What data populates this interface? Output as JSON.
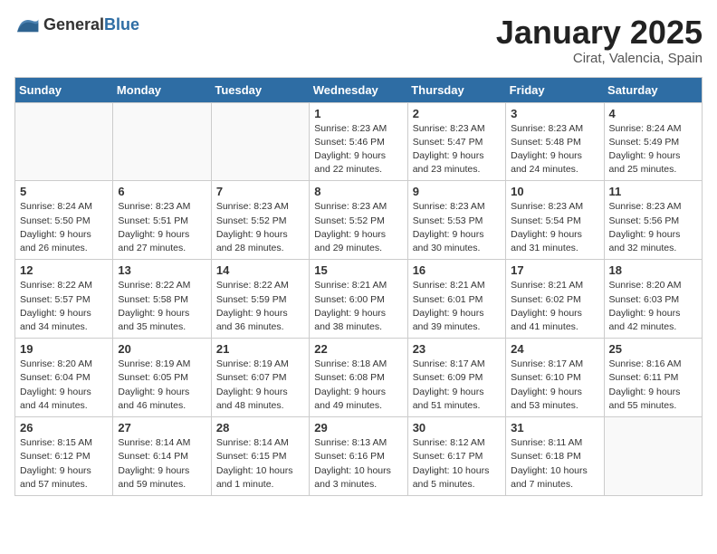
{
  "header": {
    "logo_general": "General",
    "logo_blue": "Blue",
    "title": "January 2025",
    "subtitle": "Cirat, Valencia, Spain"
  },
  "weekdays": [
    "Sunday",
    "Monday",
    "Tuesday",
    "Wednesday",
    "Thursday",
    "Friday",
    "Saturday"
  ],
  "weeks": [
    [
      {
        "day": "",
        "info": ""
      },
      {
        "day": "",
        "info": ""
      },
      {
        "day": "",
        "info": ""
      },
      {
        "day": "1",
        "info": "Sunrise: 8:23 AM\nSunset: 5:46 PM\nDaylight: 9 hours\nand 22 minutes."
      },
      {
        "day": "2",
        "info": "Sunrise: 8:23 AM\nSunset: 5:47 PM\nDaylight: 9 hours\nand 23 minutes."
      },
      {
        "day": "3",
        "info": "Sunrise: 8:23 AM\nSunset: 5:48 PM\nDaylight: 9 hours\nand 24 minutes."
      },
      {
        "day": "4",
        "info": "Sunrise: 8:24 AM\nSunset: 5:49 PM\nDaylight: 9 hours\nand 25 minutes."
      }
    ],
    [
      {
        "day": "5",
        "info": "Sunrise: 8:24 AM\nSunset: 5:50 PM\nDaylight: 9 hours\nand 26 minutes."
      },
      {
        "day": "6",
        "info": "Sunrise: 8:23 AM\nSunset: 5:51 PM\nDaylight: 9 hours\nand 27 minutes."
      },
      {
        "day": "7",
        "info": "Sunrise: 8:23 AM\nSunset: 5:52 PM\nDaylight: 9 hours\nand 28 minutes."
      },
      {
        "day": "8",
        "info": "Sunrise: 8:23 AM\nSunset: 5:52 PM\nDaylight: 9 hours\nand 29 minutes."
      },
      {
        "day": "9",
        "info": "Sunrise: 8:23 AM\nSunset: 5:53 PM\nDaylight: 9 hours\nand 30 minutes."
      },
      {
        "day": "10",
        "info": "Sunrise: 8:23 AM\nSunset: 5:54 PM\nDaylight: 9 hours\nand 31 minutes."
      },
      {
        "day": "11",
        "info": "Sunrise: 8:23 AM\nSunset: 5:56 PM\nDaylight: 9 hours\nand 32 minutes."
      }
    ],
    [
      {
        "day": "12",
        "info": "Sunrise: 8:22 AM\nSunset: 5:57 PM\nDaylight: 9 hours\nand 34 minutes."
      },
      {
        "day": "13",
        "info": "Sunrise: 8:22 AM\nSunset: 5:58 PM\nDaylight: 9 hours\nand 35 minutes."
      },
      {
        "day": "14",
        "info": "Sunrise: 8:22 AM\nSunset: 5:59 PM\nDaylight: 9 hours\nand 36 minutes."
      },
      {
        "day": "15",
        "info": "Sunrise: 8:21 AM\nSunset: 6:00 PM\nDaylight: 9 hours\nand 38 minutes."
      },
      {
        "day": "16",
        "info": "Sunrise: 8:21 AM\nSunset: 6:01 PM\nDaylight: 9 hours\nand 39 minutes."
      },
      {
        "day": "17",
        "info": "Sunrise: 8:21 AM\nSunset: 6:02 PM\nDaylight: 9 hours\nand 41 minutes."
      },
      {
        "day": "18",
        "info": "Sunrise: 8:20 AM\nSunset: 6:03 PM\nDaylight: 9 hours\nand 42 minutes."
      }
    ],
    [
      {
        "day": "19",
        "info": "Sunrise: 8:20 AM\nSunset: 6:04 PM\nDaylight: 9 hours\nand 44 minutes."
      },
      {
        "day": "20",
        "info": "Sunrise: 8:19 AM\nSunset: 6:05 PM\nDaylight: 9 hours\nand 46 minutes."
      },
      {
        "day": "21",
        "info": "Sunrise: 8:19 AM\nSunset: 6:07 PM\nDaylight: 9 hours\nand 48 minutes."
      },
      {
        "day": "22",
        "info": "Sunrise: 8:18 AM\nSunset: 6:08 PM\nDaylight: 9 hours\nand 49 minutes."
      },
      {
        "day": "23",
        "info": "Sunrise: 8:17 AM\nSunset: 6:09 PM\nDaylight: 9 hours\nand 51 minutes."
      },
      {
        "day": "24",
        "info": "Sunrise: 8:17 AM\nSunset: 6:10 PM\nDaylight: 9 hours\nand 53 minutes."
      },
      {
        "day": "25",
        "info": "Sunrise: 8:16 AM\nSunset: 6:11 PM\nDaylight: 9 hours\nand 55 minutes."
      }
    ],
    [
      {
        "day": "26",
        "info": "Sunrise: 8:15 AM\nSunset: 6:12 PM\nDaylight: 9 hours\nand 57 minutes."
      },
      {
        "day": "27",
        "info": "Sunrise: 8:14 AM\nSunset: 6:14 PM\nDaylight: 9 hours\nand 59 minutes."
      },
      {
        "day": "28",
        "info": "Sunrise: 8:14 AM\nSunset: 6:15 PM\nDaylight: 10 hours\nand 1 minute."
      },
      {
        "day": "29",
        "info": "Sunrise: 8:13 AM\nSunset: 6:16 PM\nDaylight: 10 hours\nand 3 minutes."
      },
      {
        "day": "30",
        "info": "Sunrise: 8:12 AM\nSunset: 6:17 PM\nDaylight: 10 hours\nand 5 minutes."
      },
      {
        "day": "31",
        "info": "Sunrise: 8:11 AM\nSunset: 6:18 PM\nDaylight: 10 hours\nand 7 minutes."
      },
      {
        "day": "",
        "info": ""
      }
    ]
  ]
}
